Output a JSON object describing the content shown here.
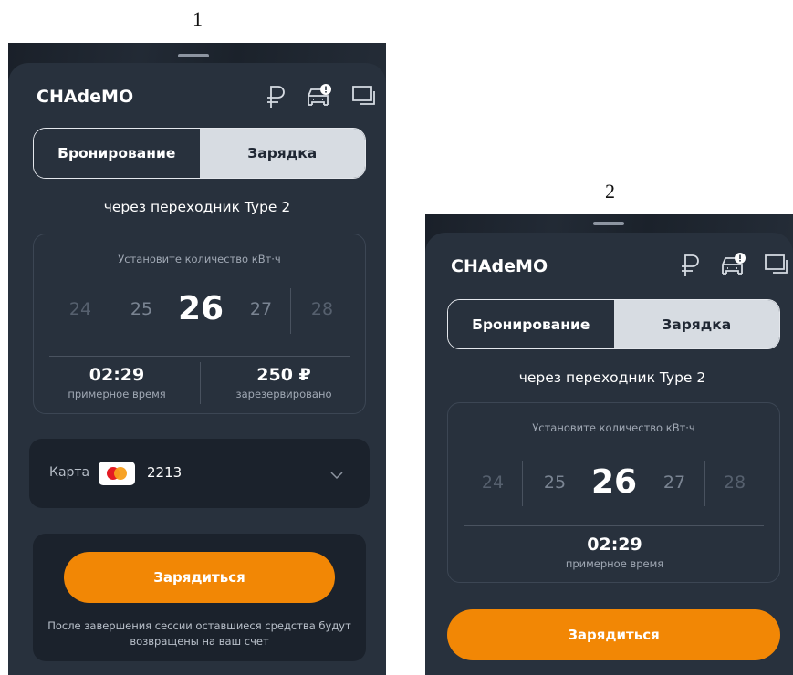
{
  "figure_labels": [
    "1",
    "2"
  ],
  "screens": [
    {
      "title": "CHAdeMO",
      "header_icons": [
        "ruble-icon",
        "car-alert-icon",
        "chat-icon"
      ],
      "tabs": [
        {
          "label": "Бронирование",
          "active": true
        },
        {
          "label": "Зарядка",
          "active": false
        }
      ],
      "adapter_text": "через переходник Type 2",
      "picker": {
        "caption": "Установите количество кВт·ч",
        "values": [
          "24",
          "25",
          "26",
          "27",
          "28"
        ],
        "selected": "26"
      },
      "stats": [
        {
          "value": "02:29",
          "label": "примерное время"
        },
        {
          "value": "250 ₽",
          "label": "зарезервировано"
        }
      ],
      "payment": {
        "label": "Карта",
        "card_icon": "mastercard-icon",
        "card_number": "2213"
      },
      "charge_button": "Зарядиться",
      "note": "После завершения сессии оставшиеся средства будут возвращены на ваш счет"
    },
    {
      "title": "CHAdeMO",
      "header_icons": [
        "ruble-icon",
        "car-alert-icon",
        "chat-icon"
      ],
      "tabs": [
        {
          "label": "Бронирование",
          "active": true
        },
        {
          "label": "Зарядка",
          "active": false
        }
      ],
      "adapter_text": "через переходник Type 2",
      "picker": {
        "caption": "Установите количество кВт·ч",
        "values": [
          "24",
          "25",
          "26",
          "27",
          "28"
        ],
        "selected": "26"
      },
      "stats": [
        {
          "value": "02:29",
          "label": "примерное время"
        }
      ],
      "charge_button": "Зарядиться"
    }
  ],
  "colors": {
    "accent": "#f28705",
    "sheet": "#28313d",
    "inset": "#1b222c",
    "text": "#ffffff"
  }
}
